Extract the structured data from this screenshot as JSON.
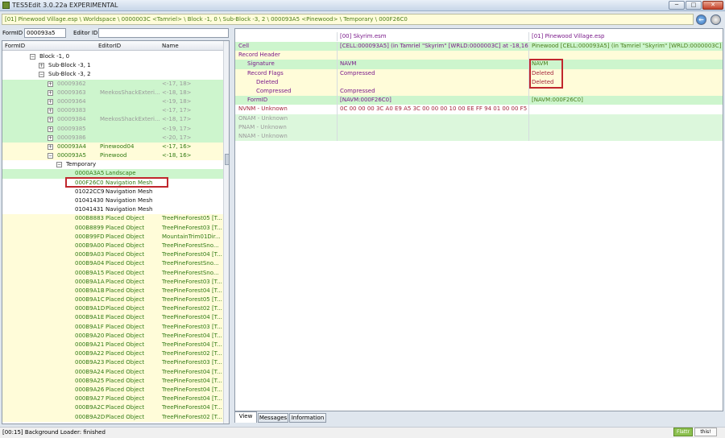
{
  "window": {
    "title": "TES5Edit 3.0.22a EXPERIMENTAL",
    "min_label": "─",
    "max_label": "□",
    "close_label": "✕"
  },
  "path_bar": "[01] Pinewood Village.esp \\ Worldspace \\ 0000003C <Tamriel> \\ Block -1, 0 \\ Sub-Block -3, 2 \\ 000093A5 <Pinewood> \\ Temporary \\ 000F26C0",
  "filter": {
    "formid_label": "FormID",
    "formid_value": "000093a5",
    "editorid_label": "Editor ID"
  },
  "tree": {
    "columns": [
      "FormID",
      "EditorID",
      "Name"
    ],
    "rows": [
      {
        "formid": "Block -1, 0",
        "editorid": "",
        "name": "",
        "indent": 1,
        "toggle": "−",
        "style": "plain"
      },
      {
        "formid": "Sub-Block -3, 1",
        "editorid": "",
        "name": "",
        "indent": 2,
        "toggle": "+",
        "style": "plain"
      },
      {
        "formid": "Sub-Block -3, 2",
        "editorid": "",
        "name": "",
        "indent": 2,
        "toggle": "−",
        "style": "plain"
      },
      {
        "formid": "00009362",
        "editorid": "",
        "name": "<-17, 18>",
        "indent": 3,
        "toggle": "+",
        "style": "grey"
      },
      {
        "formid": "00009363",
        "editorid": "MeekosShackExteri...",
        "name": "<-18, 18>",
        "indent": 3,
        "toggle": "+",
        "style": "grey"
      },
      {
        "formid": "00009364",
        "editorid": "",
        "name": "<-19, 18>",
        "indent": 3,
        "toggle": "+",
        "style": "grey"
      },
      {
        "formid": "00009383",
        "editorid": "",
        "name": "<-17, 17>",
        "indent": 3,
        "toggle": "+",
        "style": "grey"
      },
      {
        "formid": "00009384",
        "editorid": "MeekosShackExteri...",
        "name": "<-18, 17>",
        "indent": 3,
        "toggle": "+",
        "style": "grey"
      },
      {
        "formid": "00009385",
        "editorid": "",
        "name": "<-19, 17>",
        "indent": 3,
        "toggle": "+",
        "style": "grey"
      },
      {
        "formid": "00009386",
        "editorid": "",
        "name": "<-20, 17>",
        "indent": 3,
        "toggle": "+",
        "style": "grey"
      },
      {
        "formid": "000093A4",
        "editorid": "Pinewood04",
        "name": "<-17, 16>",
        "indent": 3,
        "toggle": "+",
        "style": "yellow"
      },
      {
        "formid": "000093A5",
        "editorid": "Pinewood",
        "name": "<-18, 16>",
        "indent": 3,
        "toggle": "−",
        "style": "yellow"
      },
      {
        "formid": "Temporary",
        "editorid": "",
        "name": "",
        "indent": 4,
        "toggle": "−",
        "style": "plain"
      },
      {
        "formid": "0000A3A5",
        "editorid": "Landscape",
        "name": "",
        "indent": 5,
        "toggle": "",
        "style": "green",
        "inline": true
      },
      {
        "formid": "000F26C0",
        "editorid": "Navigation Mesh",
        "name": "",
        "indent": 5,
        "toggle": "",
        "style": "selected",
        "inline": true
      },
      {
        "formid": "01022CC9",
        "editorid": "Navigation Mesh",
        "name": "",
        "indent": 5,
        "toggle": "",
        "style": "plain",
        "inline": true
      },
      {
        "formid": "01041430",
        "editorid": "Navigation Mesh",
        "name": "",
        "indent": 5,
        "toggle": "",
        "style": "plain",
        "inline": true
      },
      {
        "formid": "01041431",
        "editorid": "Navigation Mesh",
        "name": "",
        "indent": 5,
        "toggle": "",
        "style": "plain",
        "inline": true
      },
      {
        "formid": "000B8883",
        "editorid": "Placed Object",
        "name": "TreePineForest05 [T...",
        "indent": 5,
        "toggle": "",
        "style": "yellow",
        "inline": true
      },
      {
        "formid": "000B8899",
        "editorid": "Placed Object",
        "name": "TreePineForest03 [T...",
        "indent": 5,
        "toggle": "",
        "style": "yellow",
        "inline": true
      },
      {
        "formid": "000B99FD",
        "editorid": "Placed Object",
        "name": "MountainTrim01Dir...",
        "indent": 5,
        "toggle": "",
        "style": "yellow",
        "inline": true
      },
      {
        "formid": "000B9A00",
        "editorid": "Placed Object",
        "name": "TreePineForestSno...",
        "indent": 5,
        "toggle": "",
        "style": "yellow",
        "inline": true
      },
      {
        "formid": "000B9A03",
        "editorid": "Placed Object",
        "name": "TreePineForest04 [T...",
        "indent": 5,
        "toggle": "",
        "style": "yellow",
        "inline": true
      },
      {
        "formid": "000B9A04",
        "editorid": "Placed Object",
        "name": "TreePineForestSno...",
        "indent": 5,
        "toggle": "",
        "style": "yellow",
        "inline": true
      },
      {
        "formid": "000B9A15",
        "editorid": "Placed Object",
        "name": "TreePineForestSno...",
        "indent": 5,
        "toggle": "",
        "style": "yellow",
        "inline": true
      },
      {
        "formid": "000B9A1A",
        "editorid": "Placed Object",
        "name": "TreePineForest03 [T...",
        "indent": 5,
        "toggle": "",
        "style": "yellow",
        "inline": true
      },
      {
        "formid": "000B9A1B",
        "editorid": "Placed Object",
        "name": "TreePineForest04 [T...",
        "indent": 5,
        "toggle": "",
        "style": "yellow",
        "inline": true
      },
      {
        "formid": "000B9A1C",
        "editorid": "Placed Object",
        "name": "TreePineForest05 [T...",
        "indent": 5,
        "toggle": "",
        "style": "yellow",
        "inline": true
      },
      {
        "formid": "000B9A1D",
        "editorid": "Placed Object",
        "name": "TreePineForest02 [T...",
        "indent": 5,
        "toggle": "",
        "style": "yellow",
        "inline": true
      },
      {
        "formid": "000B9A1E",
        "editorid": "Placed Object",
        "name": "TreePineForest04 [T...",
        "indent": 5,
        "toggle": "",
        "style": "yellow",
        "inline": true
      },
      {
        "formid": "000B9A1F",
        "editorid": "Placed Object",
        "name": "TreePineForest03 [T...",
        "indent": 5,
        "toggle": "",
        "style": "yellow",
        "inline": true
      },
      {
        "formid": "000B9A20",
        "editorid": "Placed Object",
        "name": "TreePineForest04 [T...",
        "indent": 5,
        "toggle": "",
        "style": "yellow",
        "inline": true
      },
      {
        "formid": "000B9A21",
        "editorid": "Placed Object",
        "name": "TreePineForest04 [T...",
        "indent": 5,
        "toggle": "",
        "style": "yellow",
        "inline": true
      },
      {
        "formid": "000B9A22",
        "editorid": "Placed Object",
        "name": "TreePineForest02 [T...",
        "indent": 5,
        "toggle": "",
        "style": "yellow",
        "inline": true
      },
      {
        "formid": "000B9A23",
        "editorid": "Placed Object",
        "name": "TreePineForest03 [T...",
        "indent": 5,
        "toggle": "",
        "style": "yellow",
        "inline": true
      },
      {
        "formid": "000B9A24",
        "editorid": "Placed Object",
        "name": "TreePineForest04 [T...",
        "indent": 5,
        "toggle": "",
        "style": "yellow",
        "inline": true
      },
      {
        "formid": "000B9A25",
        "editorid": "Placed Object",
        "name": "TreePineForest04 [T...",
        "indent": 5,
        "toggle": "",
        "style": "yellow",
        "inline": true
      },
      {
        "formid": "000B9A26",
        "editorid": "Placed Object",
        "name": "TreePineForest04 [T...",
        "indent": 5,
        "toggle": "",
        "style": "yellow",
        "inline": true
      },
      {
        "formid": "000B9A27",
        "editorid": "Placed Object",
        "name": "TreePineForest04 [T...",
        "indent": 5,
        "toggle": "",
        "style": "yellow",
        "inline": true
      },
      {
        "formid": "000B9A2C",
        "editorid": "Placed Object",
        "name": "TreePineForest04 [T...",
        "indent": 5,
        "toggle": "",
        "style": "yellow",
        "inline": true
      },
      {
        "formid": "000B9A2D",
        "editorid": "Placed Object",
        "name": "TreePineForest02 [T...",
        "indent": 5,
        "toggle": "",
        "style": "yellow",
        "inline": true
      }
    ]
  },
  "record_view": {
    "headers": [
      "",
      "[00] Skyrim.esm",
      "[01] Pinewood Village.esp"
    ],
    "rows": [
      {
        "label": "Cell",
        "indent": 0,
        "v1": "[CELL:000093A5] (in Tamriel \"Skyrim\" [WRLD:0000003C] at -18,16)",
        "v2": "Pinewood [CELL:000093A5] (in Tamriel \"Skyrim\" [WRLD:0000003C] a...",
        "bg": "green",
        "c0": "purple",
        "c1": "purple",
        "c2": "olive"
      },
      {
        "label": "Record Header",
        "indent": 0,
        "v1": "",
        "v2": "",
        "bg": "yellow",
        "c0": "purple",
        "c1": "purple",
        "c2": "olive"
      },
      {
        "label": "Signature",
        "indent": 1,
        "v1": "NAVM",
        "v2": "NAVM",
        "bg": "green",
        "c0": "purple",
        "c1": "purple",
        "c2": "olive"
      },
      {
        "label": "Record Flags",
        "indent": 1,
        "v1": "Compressed",
        "v2": "Deleted",
        "bg": "yellow",
        "c0": "purple",
        "c1": "purple",
        "c2": "red"
      },
      {
        "label": "Deleted",
        "indent": 2,
        "v1": "",
        "v2": "Deleted",
        "bg": "yellow",
        "c0": "purple",
        "c1": "purple",
        "c2": "red"
      },
      {
        "label": "Compressed",
        "indent": 2,
        "v1": "Compressed",
        "v2": "",
        "bg": "yellow",
        "c0": "purple",
        "c1": "purple",
        "c2": "red"
      },
      {
        "label": "FormID",
        "indent": 1,
        "v1": "[NAVM:000F26C0]",
        "v2": "[NAVM:000F26C0]",
        "bg": "green",
        "c0": "purple",
        "c1": "purple",
        "c2": "olive"
      },
      {
        "label": "NVNM - Unknown",
        "indent": 0,
        "v1": "0C 00 00 00 3C A0 E9 A5 3C 00 00 00 10 00 EE FF 94 01 00 00 F5 66 8A ...",
        "v2": "",
        "bg": "white",
        "c0": "red",
        "c1": "red",
        "c2": "red"
      },
      {
        "label": "ONAM - Unknown",
        "indent": 0,
        "v1": "",
        "v2": "",
        "bg": "lgreen",
        "c0": "grey",
        "c1": "grey",
        "c2": "grey"
      },
      {
        "label": "PNAM - Unknown",
        "indent": 0,
        "v1": "",
        "v2": "",
        "bg": "lgreen",
        "c0": "grey",
        "c1": "grey",
        "c2": "grey"
      },
      {
        "label": "NNAM - Unknown",
        "indent": 0,
        "v1": "",
        "v2": "",
        "bg": "lgreen",
        "c0": "grey",
        "c1": "grey",
        "c2": "grey"
      }
    ]
  },
  "tabs": [
    "View",
    "Messages",
    "Information"
  ],
  "status": {
    "text": "[00:15] Background Loader: finished",
    "flattr": "Flattr",
    "this": "this!"
  }
}
